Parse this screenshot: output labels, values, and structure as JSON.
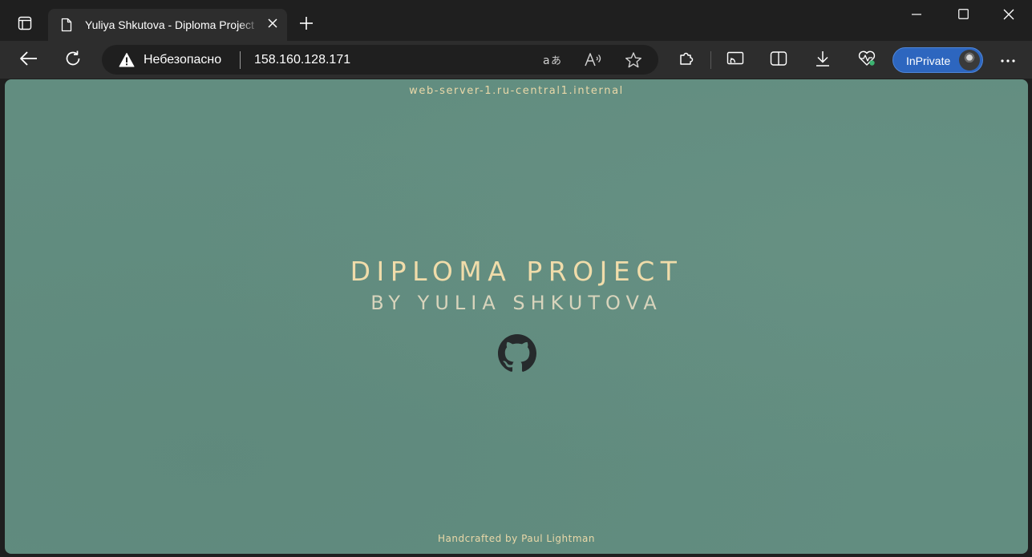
{
  "browser": {
    "tab": {
      "title": "Yuliya Shkutova - Diploma Project"
    },
    "address_bar": {
      "security_label": "Небезопасно",
      "url": "158.160.128.171"
    },
    "profile": {
      "label": "InPrivate"
    }
  },
  "page": {
    "server_name": "web-server-1.ru-central1.internal",
    "title": "DIPLOMA PROJECT",
    "subtitle": "BY YULIA SHKUTOVA",
    "footer": "Handcrafted by Paul Lightman"
  },
  "colors": {
    "page_background": "#628d80",
    "title_text": "#f0dcaa",
    "subtitle_text": "#d8d4bc",
    "accent_text": "#ead8a8",
    "inprivate_badge": "#2d66bf",
    "browser_chrome": "#2d2d2d",
    "browser_frame": "#1f1f1f"
  },
  "icons": {
    "tab_actions": "tab-actions-icon",
    "tab_page": "page-icon",
    "tab_close": "close-icon",
    "new_tab": "plus-icon",
    "minimize": "minimize-icon",
    "maximize": "maximize-icon",
    "close_window": "close-window-icon",
    "back": "back-arrow-icon",
    "refresh": "refresh-icon",
    "not_secure": "warning-icon",
    "translate": "translate-icon",
    "read_aloud": "read-aloud-icon",
    "favorite": "star-icon",
    "extensions": "puzzle-icon",
    "cast": "cast-icon",
    "split_screen": "split-screen-icon",
    "downloads": "download-icon",
    "browser_essentials": "heart-pulse-icon",
    "more": "more-icon",
    "github": "github-icon"
  }
}
